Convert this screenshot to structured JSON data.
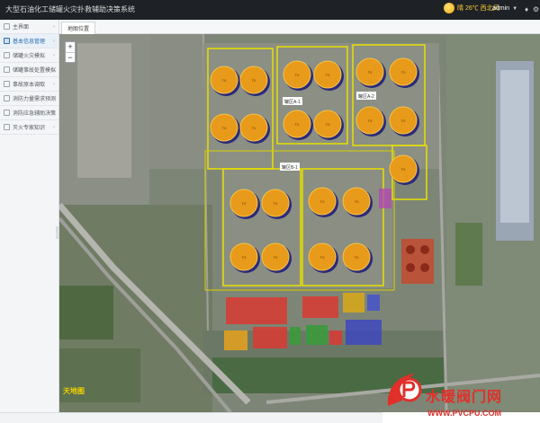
{
  "header": {
    "title": "大型石油化工储罐火灾扑救辅助决策系统",
    "weather": "晴 26℃ 西北风",
    "user": "admin"
  },
  "sidebar": {
    "items": [
      {
        "label": "主界面"
      },
      {
        "label": "基本信息管理"
      },
      {
        "label": "储罐火灾模拟"
      },
      {
        "label": "储罐事故处置模拟"
      },
      {
        "label": "事故原本调取"
      },
      {
        "label": "消防力量需求预测"
      },
      {
        "label": "消防应急辅助决策"
      },
      {
        "label": "灭火专家知识"
      }
    ]
  },
  "tabs": [
    {
      "label": "地图位置"
    }
  ],
  "map": {
    "zoom_in": "+",
    "zoom_out": "−",
    "tank_label": "T0",
    "zone_labels": [
      "罐区A-1",
      "罐区A-2",
      "罐区B-1"
    ],
    "logo": "天地图"
  },
  "watermark": {
    "title": "水暖阀门网",
    "url": "WWW.PVCPU.COM"
  },
  "colors": {
    "header_bg": "#1e2226",
    "tank_fill": "#e89a1a",
    "tank_rim": "#2b2a7a",
    "zone_outline": "#e8e000",
    "accent": "#2a6db0",
    "watermark_red": "#e0302a"
  },
  "icons": {
    "weather": "sun-icon",
    "user_caret": "chevron-down-icon",
    "notifications": "bell-icon",
    "settings": "gear-icon",
    "zoom_in": "plus-icon",
    "zoom_out": "minus-icon"
  }
}
